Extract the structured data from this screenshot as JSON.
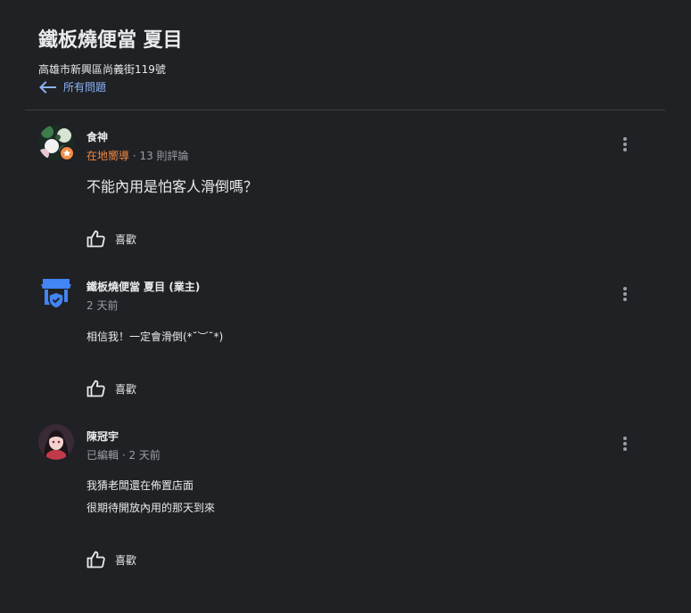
{
  "header": {
    "title": "鐵板燒便當 夏目",
    "address": "高雄市新興區尚義街119號",
    "back_label": "所有問題"
  },
  "question": {
    "author": "食神",
    "badge": "在地嚮導",
    "separator": " · ",
    "review_count": "13 則評論",
    "text": "不能內用是怕客人滑倒嗎？",
    "like_label": "喜歡"
  },
  "answers": [
    {
      "author": "鐵板燒便當 夏目 (業主)",
      "time": "2 天前",
      "lines": [
        "相信我！一定會滑倒(*˘︶˘*)"
      ],
      "like_label": "喜歡"
    },
    {
      "author": "陳冠宇",
      "edited": "已編輯",
      "separator": " · ",
      "time": "2 天前",
      "lines": [
        "我猜老闆還在佈置店面",
        "很期待開放內用的那天到來"
      ],
      "like_label": "喜歡"
    }
  ],
  "colors": {
    "background": "#202124",
    "text": "#e8eaed",
    "secondary": "#9aa0a6",
    "link": "#8ab4f8",
    "local_guide": "#f28b46",
    "owner_icon": "#4285f4"
  },
  "icons": {
    "back": "arrow-left-icon",
    "more": "more-vert-icon",
    "like": "thumb-up-icon",
    "owner": "store-shield-icon"
  }
}
